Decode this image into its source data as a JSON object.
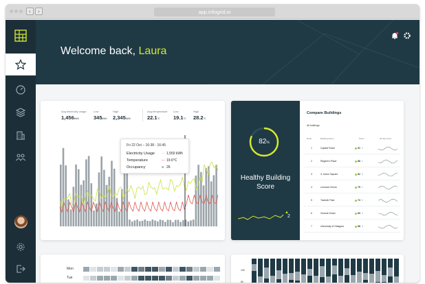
{
  "browser": {
    "url": "app.infogrid.io"
  },
  "colors": {
    "navy": "#1f3a45",
    "sidebar": "#1c2f39",
    "accent": "#d4e82d",
    "electricity": "#c9e040",
    "temperature": "#d8584e",
    "bars": "#9aa3a8"
  },
  "sidebar": {
    "items": [
      {
        "icon": "star-icon",
        "active": true
      },
      {
        "icon": "gauge-icon",
        "active": false
      },
      {
        "icon": "layers-icon",
        "active": false
      },
      {
        "icon": "building-icon",
        "active": false
      },
      {
        "icon": "people-icon",
        "active": false
      }
    ],
    "bottom": [
      {
        "icon": "avatar"
      },
      {
        "icon": "gear-icon"
      },
      {
        "icon": "logout-icon"
      }
    ]
  },
  "header": {
    "greeting": "Welcome back, ",
    "user_name": "Laura"
  },
  "usage_card": {
    "stats": [
      {
        "label": "Avg electricity usage",
        "value": "1,456",
        "unit": "kWh"
      },
      {
        "label": "Low",
        "value": "345",
        "unit": "kWh"
      },
      {
        "label": "High",
        "value": "2,345",
        "unit": "kWh"
      },
      {
        "label": "Avg temperature",
        "value": "22.1",
        "unit": "°C"
      },
      {
        "label": "Low",
        "value": "19.1",
        "unit": "°C"
      },
      {
        "label": "High",
        "value": "28.2",
        "unit": "°C"
      }
    ],
    "tooltip": {
      "title": "Fri 22 Oct – 16:38 - 16:45",
      "rows": [
        {
          "label": "Electricity Usage",
          "symbol": "—",
          "value": "1,550 kWh"
        },
        {
          "label": "Temperature",
          "symbol": "—",
          "value": "19.6°C"
        },
        {
          "label": "Occupancy",
          "symbol": "■",
          "value": "26"
        }
      ]
    }
  },
  "health": {
    "score_value": "82",
    "score_unit": "%",
    "score_fraction": 0.82,
    "title": "Healthy Building Score",
    "trend_value": "2"
  },
  "compare": {
    "title": "Compare Buildings",
    "filter": "All buildings",
    "headers": [
      "Rank",
      "Building Name",
      "Score",
      "30 day trend"
    ],
    "rows": [
      {
        "rank": "1",
        "name": "Capital Tower",
        "score": "91",
        "change": "2"
      },
      {
        "rank": "2",
        "name": "Regent's Place",
        "score": "88",
        "change": "1"
      },
      {
        "rank": "3",
        "name": "4, Union Square",
        "score": "82",
        "change": "5"
      },
      {
        "rank": "4",
        "name": "Leonard Circus",
        "score": "75",
        "change": "1"
      },
      {
        "rank": "5",
        "name": "Tweedh Park",
        "score": "73",
        "change": "3"
      },
      {
        "rank": "6",
        "name": "Victoria Tower",
        "score": "69",
        "change": "3"
      },
      {
        "rank": "7",
        "name": "University of Glasgow",
        "score": "68",
        "change": "0"
      }
    ]
  },
  "heatmap": {
    "days": [
      "Mon",
      "Tue"
    ]
  },
  "bars_card": {
    "y_ticks": [
      "100",
      "80"
    ]
  }
}
